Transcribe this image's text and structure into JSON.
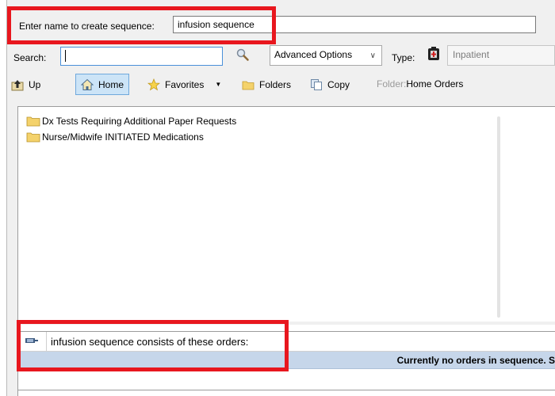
{
  "sequence_name": {
    "label": "Enter name to create sequence:",
    "value": "infusion sequence"
  },
  "search": {
    "label": "Search:",
    "value": ""
  },
  "advanced_options": {
    "selected": "Advanced Options"
  },
  "type": {
    "label": "Type:",
    "value": "Inpatient"
  },
  "toolbar": {
    "up_label": "Up",
    "home_label": "Home",
    "favorites_label": "Favorites",
    "folders_label": "Folders",
    "copy_label": "Copy",
    "folder_prefix": "Folder:",
    "folder_value": "Home Orders"
  },
  "folder_list": [
    {
      "label": "Dx Tests Requiring Additional Paper Requests",
      "icon": "folder-icon"
    },
    {
      "label": "Nurse/Midwife INITIATED Medications",
      "icon": "folder-icon"
    }
  ],
  "sequence_panel": {
    "title": "infusion sequence consists of these orders:",
    "empty_message": "Currently no orders in sequence. S"
  },
  "colors": {
    "highlight_red": "#e8171e",
    "active_tab_bg": "#cce4f7",
    "empty_row_bg": "#c6d6ea"
  }
}
